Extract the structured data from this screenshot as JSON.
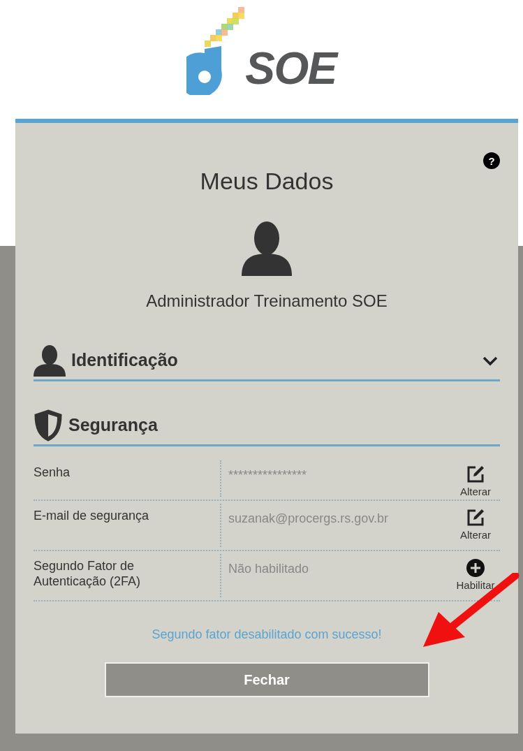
{
  "logo": {
    "text": "SOE"
  },
  "dialog": {
    "title": "Meus Dados",
    "help": "?",
    "user_name": "Administrador Treinamento SOE"
  },
  "sections": [
    {
      "kind": "identity",
      "title": "Identificação",
      "expanded": false
    },
    {
      "kind": "security",
      "title": "Segurança",
      "rows": [
        {
          "label": "Senha",
          "value": "****************",
          "action": "Alterar",
          "kind": "edit"
        },
        {
          "label": "E-mail de segurança",
          "value": "suzanak@procergs.rs.gov.br",
          "action": "Alterar",
          "kind": "edit"
        },
        {
          "label": "Segundo Fator de Autenticação (2FA)",
          "value": "Não habilitado",
          "action": "Habilitar",
          "kind": "add"
        }
      ]
    }
  ],
  "message": "Segundo fator desabilitado com sucesso!",
  "close_button": "Fechar"
}
